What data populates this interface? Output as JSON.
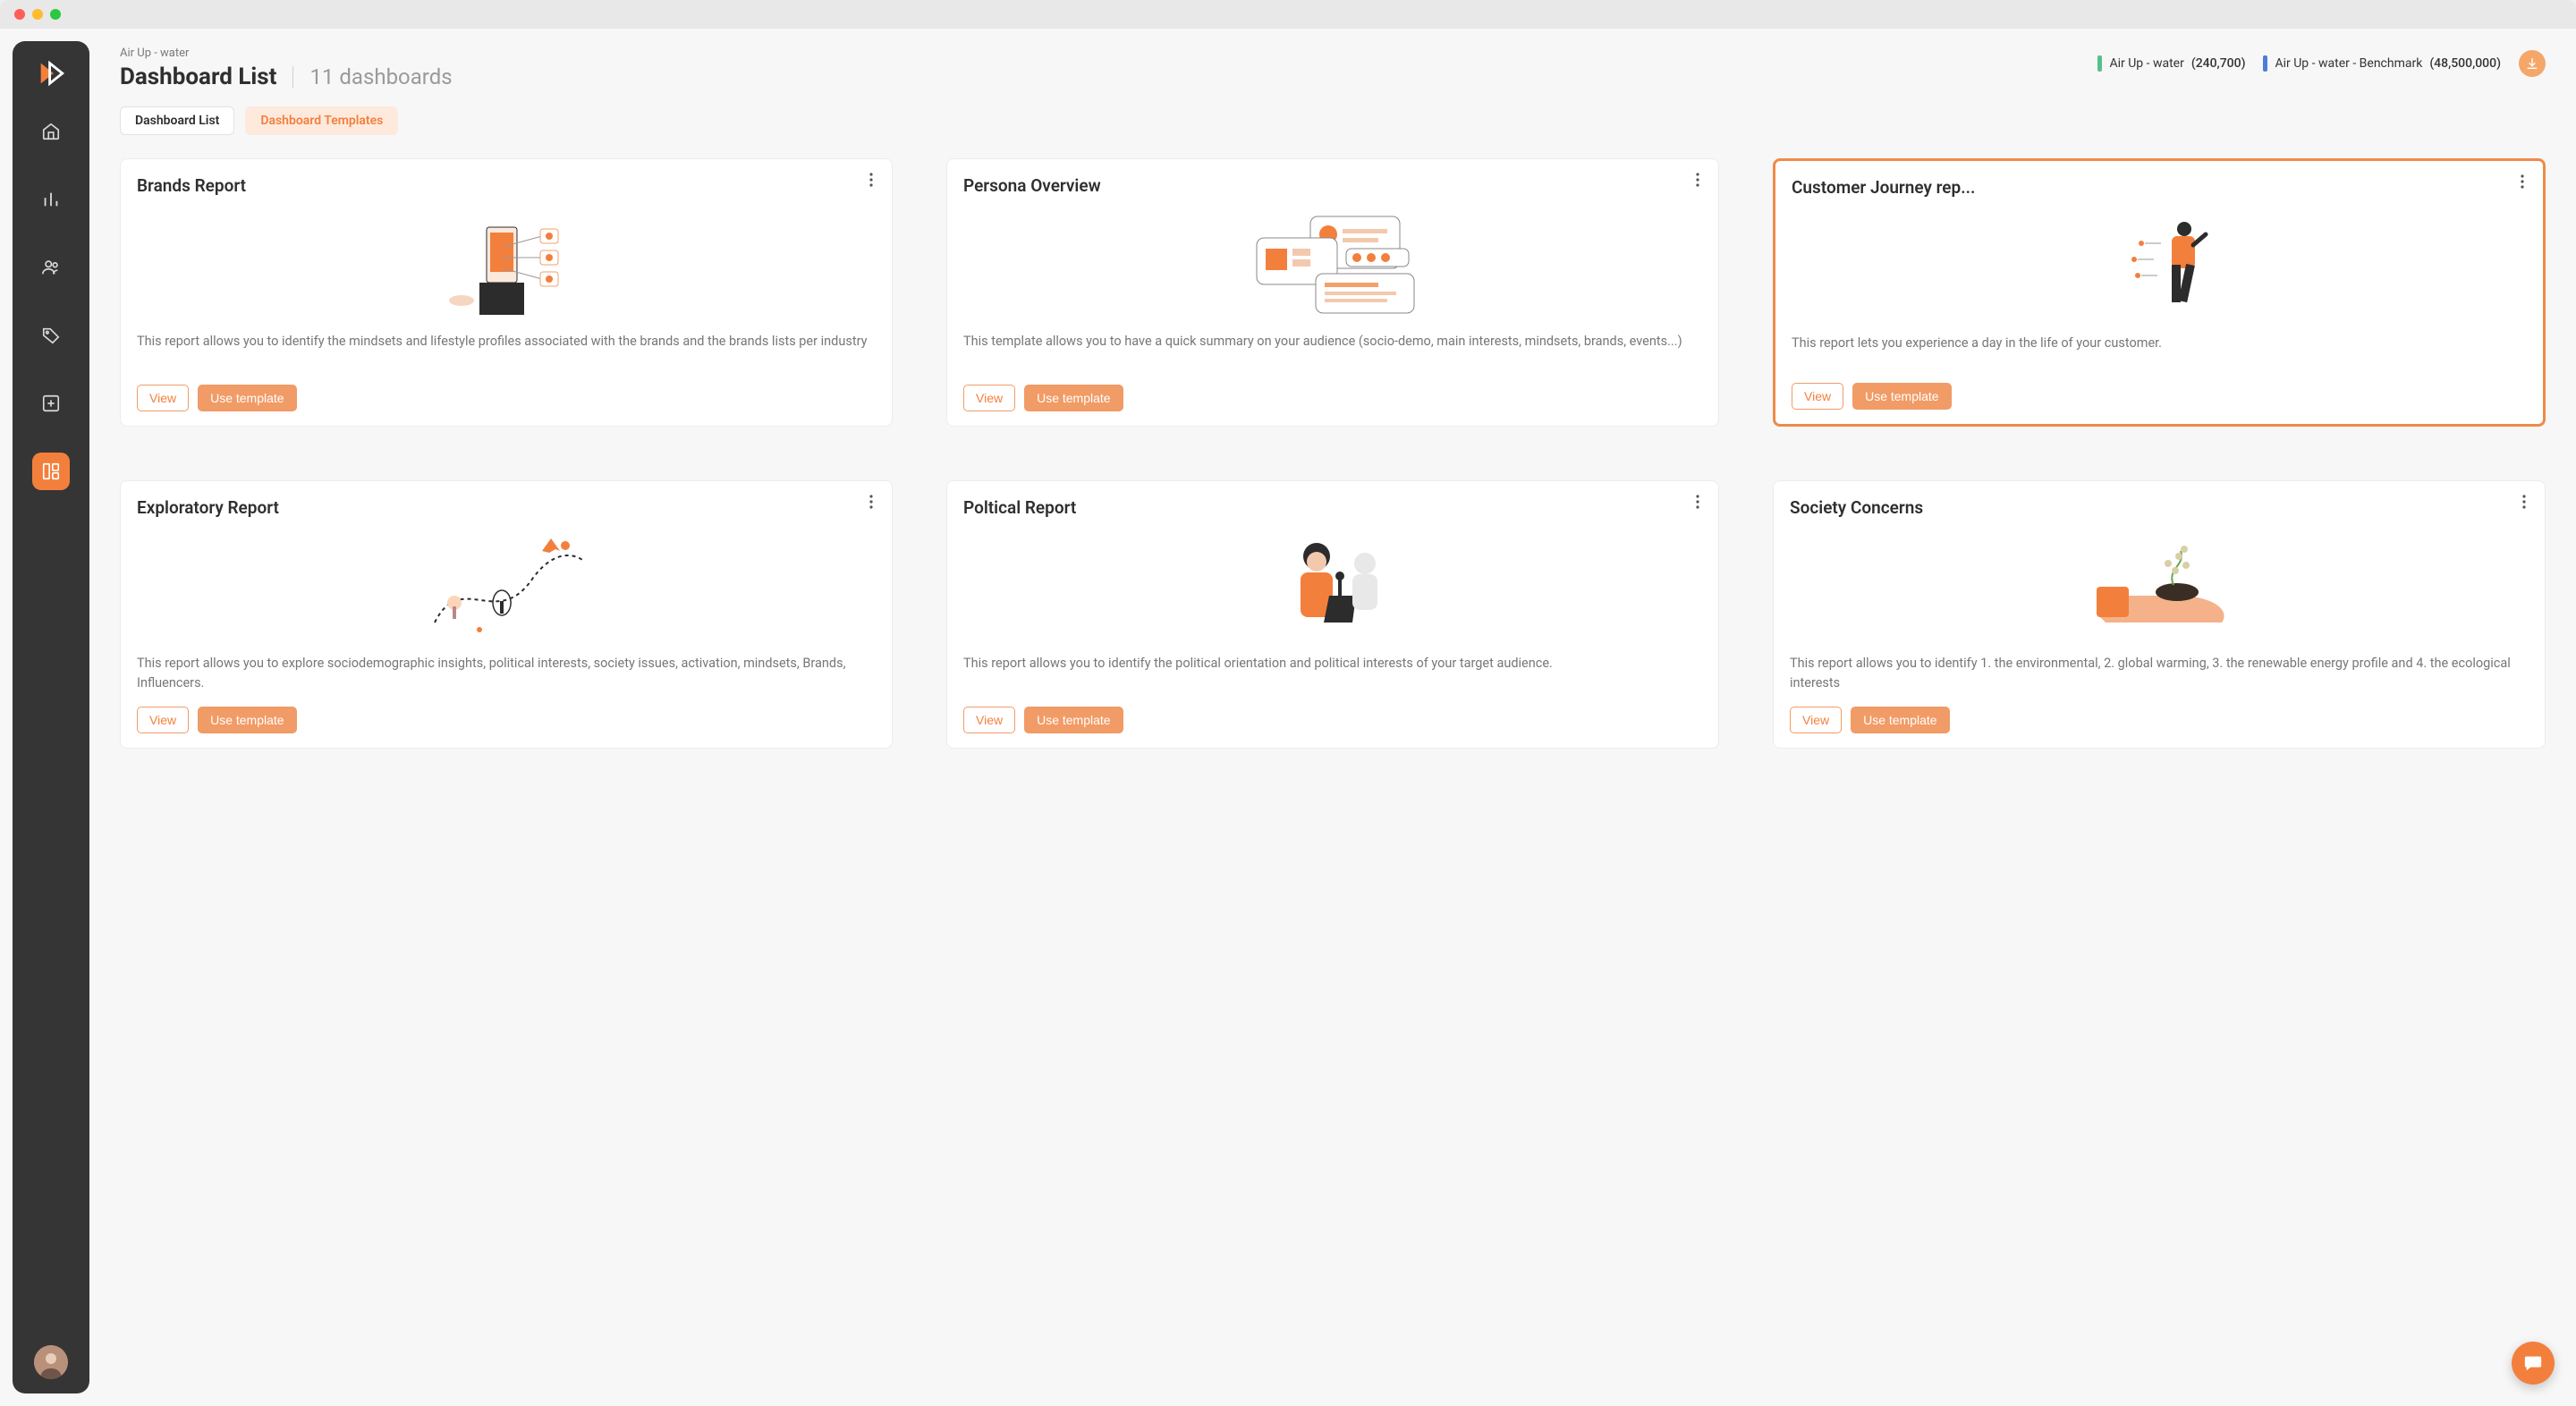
{
  "breadcrumb": "Air Up - water",
  "page_title": "Dashboard List",
  "subtitle": "11 dashboards",
  "legend": [
    {
      "color_class": "lg-green",
      "label": "Air Up - water",
      "count": "(240,700)"
    },
    {
      "color_class": "lg-blue",
      "label": "Air Up - water - Benchmark",
      "count": "(48,500,000)"
    }
  ],
  "tabs": [
    {
      "label": "Dashboard List",
      "active": false
    },
    {
      "label": "Dashboard Templates",
      "active": true
    }
  ],
  "buttons": {
    "view": "View",
    "use_template": "Use template"
  },
  "cards": [
    {
      "title": "Brands Report",
      "desc": "This report allows you to identify the mindsets and lifestyle profiles associated with the brands and the brands lists per industry",
      "highlight": false
    },
    {
      "title": "Persona Overview",
      "desc": "This template allows you to have a quick summary on your audience (socio-demo, main interests, mindsets, brands, events...)",
      "highlight": false
    },
    {
      "title": "Customer Journey rep...",
      "desc": "This report lets you experience a day in the life of your customer.",
      "highlight": true
    },
    {
      "title": "Exploratory Report",
      "desc": "This report allows you to explore sociodemographic insights, political interests, society issues, activation, mindsets, Brands, Influencers.",
      "highlight": false
    },
    {
      "title": "Poltical Report",
      "desc": "This report allows you to identify the political orientation and political interests of your target audience.",
      "highlight": false
    },
    {
      "title": "Society Concerns",
      "desc": "This report allows you to identify 1. the environmental, 2. global warming, 3. the renewable energy profile and 4. the ecological interests",
      "highlight": false
    }
  ],
  "sidebar": {
    "items": [
      {
        "name": "home"
      },
      {
        "name": "analytics"
      },
      {
        "name": "audience"
      },
      {
        "name": "tags"
      },
      {
        "name": "add"
      },
      {
        "name": "dashboard",
        "active": true
      }
    ]
  }
}
